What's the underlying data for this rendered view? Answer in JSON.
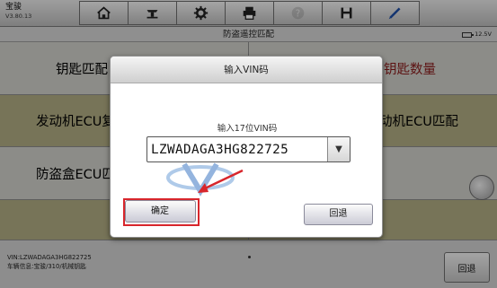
{
  "app": {
    "name": "宝骏",
    "version": "V3.80.13"
  },
  "toolbar": {
    "buttons": [
      {
        "icon": "home-icon"
      },
      {
        "icon": "vehicle-lift-icon"
      },
      {
        "icon": "gear-icon"
      },
      {
        "icon": "printer-icon"
      },
      {
        "icon": "help-icon",
        "disabled": true
      },
      {
        "icon": "save-icon"
      },
      {
        "icon": "pen-icon"
      }
    ]
  },
  "titlebar": {
    "title": "防盗遥控匹配",
    "battery": "12.5V"
  },
  "functions": {
    "key_match": "钥匙匹配",
    "key_count": "钥匙数量",
    "engine_ecu_replace": "发动机ECU复",
    "engine_ecu_match": "动机ECU匹配",
    "immo_ecu": "防盗盒ECU匹"
  },
  "bottom": {
    "vin_line": "VIN:LZWADAGA3HG822725",
    "vehicle_line": "车辆信息:宝骏/310/机械钥匙",
    "back_label": "回退"
  },
  "dialog": {
    "title": "输入VIN码",
    "prompt": "输入17位VIN码",
    "vin_value": "LZWADAGA3HG822725",
    "dropdown_glyph": "▼",
    "ok_label": "确定",
    "back_label": "回退"
  },
  "colors": {
    "highlight": "#d8262c",
    "olive_row": "#b2ae84",
    "light_row": "#d1d1cb"
  }
}
